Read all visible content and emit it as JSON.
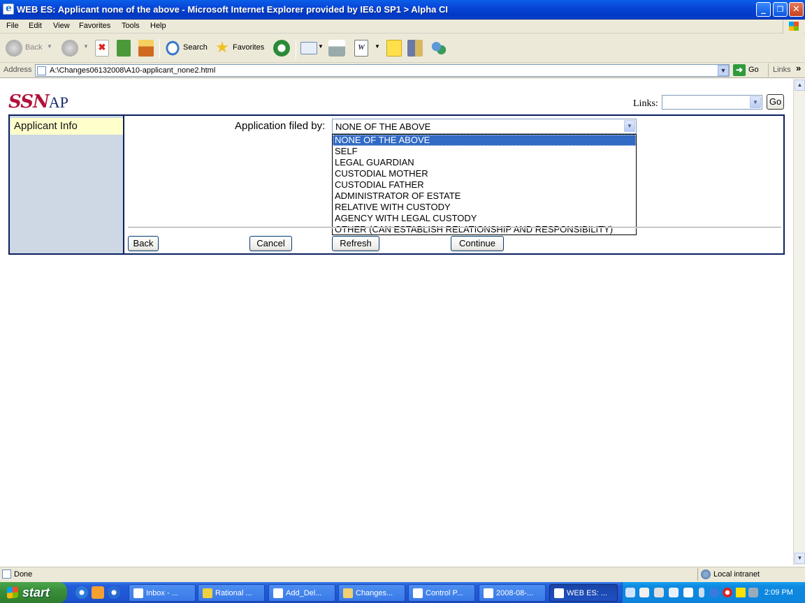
{
  "window": {
    "title": "WEB ES: Applicant none of the above - Microsoft Internet Explorer provided by IE6.0 SP1  > Alpha CI",
    "minimize": "_",
    "maximize": "❐",
    "close": "✕"
  },
  "menu": [
    "File",
    "Edit",
    "View",
    "Favorites",
    "Tools",
    "Help"
  ],
  "toolbar": {
    "back": "Back",
    "search": "Search",
    "favorites": "Favorites"
  },
  "address": {
    "label": "Address",
    "url": "A:\\Changes06132008\\A10-applicant_none2.html",
    "go": "Go",
    "links": "Links",
    "more": "»"
  },
  "page": {
    "logo_ssn": "SSN",
    "logo_ap": "AP",
    "links_label": "Links:",
    "go_button": "Go",
    "side_tab": "Applicant Info",
    "filed_label": "Application filed by:",
    "filed_value": "NONE OF THE ABOVE",
    "options": [
      "NONE OF THE ABOVE",
      "SELF",
      "LEGAL GUARDIAN",
      "CUSTODIAL MOTHER",
      "CUSTODIAL FATHER",
      "ADMINISTRATOR OF ESTATE",
      "RELATIVE WITH CUSTODY",
      "AGENCY WITH LEGAL CUSTODY",
      "OTHER (CAN ESTABLISH RELATIONSHIP AND RESPONSIBILITY)"
    ],
    "buttons": {
      "back": "Back",
      "cancel": "Cancel",
      "refresh": "Refresh",
      "continue": "Continue"
    }
  },
  "status": {
    "text": "Done",
    "zone": "Local intranet"
  },
  "taskbar": {
    "start": "start",
    "tasks": [
      "Inbox - ...",
      "Rational ...",
      "Add_Del...",
      "Changes...",
      "Control P...",
      "2008-08-...",
      "WEB ES: ..."
    ],
    "clock": "2:09 PM"
  },
  "colors": {
    "titlebar": "#0846d8",
    "selection": "#316ac5",
    "frame_border": "#0a1f5e",
    "side_panel": "#cdd8e4",
    "side_tab": "#ffffcc",
    "logo_red": "#b0133a"
  }
}
